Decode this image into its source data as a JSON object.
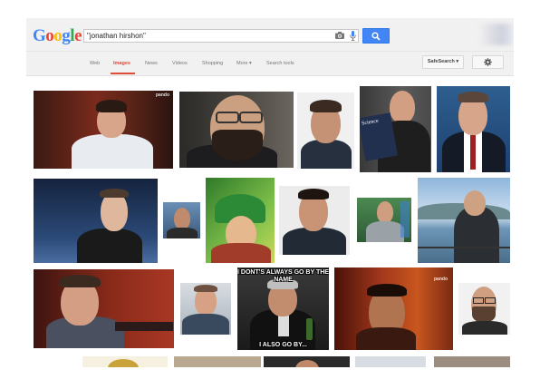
{
  "header": {
    "logo_letters": [
      {
        "ch": "G",
        "color": "#4285f4"
      },
      {
        "ch": "o",
        "color": "#ea4335"
      },
      {
        "ch": "o",
        "color": "#fbbc05"
      },
      {
        "ch": "g",
        "color": "#4285f4"
      },
      {
        "ch": "l",
        "color": "#34a853"
      },
      {
        "ch": "e",
        "color": "#ea4335"
      }
    ],
    "search_query": "\"jonathan hirshon\"",
    "camera_icon": "camera-icon",
    "mic_icon": "microphone-icon",
    "search_button_icon": "magnifier-icon"
  },
  "nav": {
    "tabs": [
      "Web",
      "Images",
      "News",
      "Videos",
      "Shopping",
      "More ▾",
      "Search tools"
    ],
    "active_tab": "Images",
    "safesearch_label": "SafeSearch ▾",
    "settings_icon": "gear-icon",
    "accent_color": "#dd4b39"
  },
  "results": {
    "watermark_1": "pando",
    "watermark_2": "pando",
    "watermark_3": "pando",
    "book_title": "Science",
    "meme_top": "I DONT'S ALWAYS GO BY THE NAME",
    "meme_bottom": "I ALSO GO BY..."
  }
}
